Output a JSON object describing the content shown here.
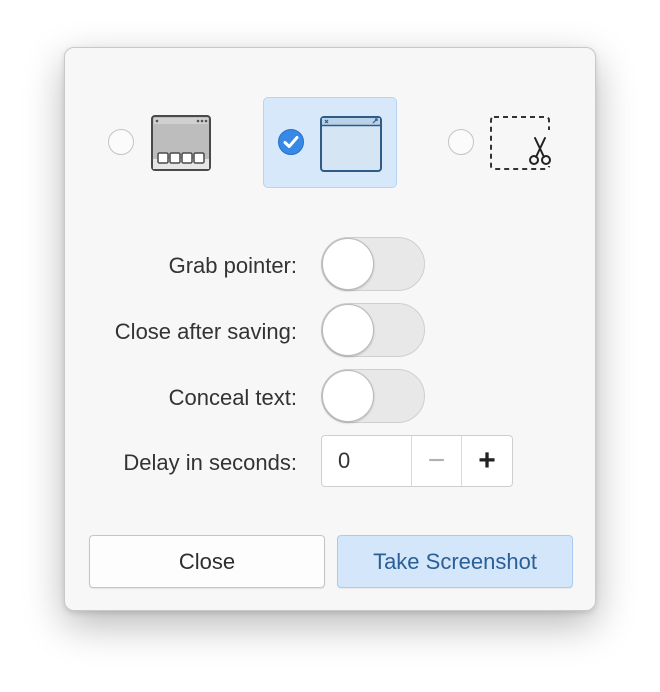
{
  "capture_modes": [
    {
      "name": "Entire screen",
      "icon": "screen-icon",
      "selected": false
    },
    {
      "name": "Active window",
      "icon": "window-icon",
      "selected": true
    },
    {
      "name": "Select area",
      "icon": "area-select-icon",
      "selected": false
    }
  ],
  "options": {
    "grab_pointer": {
      "label": "Grab pointer:",
      "on": false
    },
    "close_after_saving": {
      "label": "Close after saving:",
      "on": false
    },
    "conceal_text": {
      "label": "Conceal text:",
      "on": false
    }
  },
  "delay": {
    "label": "Delay in seconds:",
    "value": "0",
    "minus": "−",
    "plus": "+"
  },
  "buttons": {
    "close": "Close",
    "take_screenshot": "Take Screenshot"
  },
  "colors": {
    "accent": "#3689e6",
    "selected_bg": "#d6e8fa",
    "suggested_text": "#2b5f96"
  }
}
